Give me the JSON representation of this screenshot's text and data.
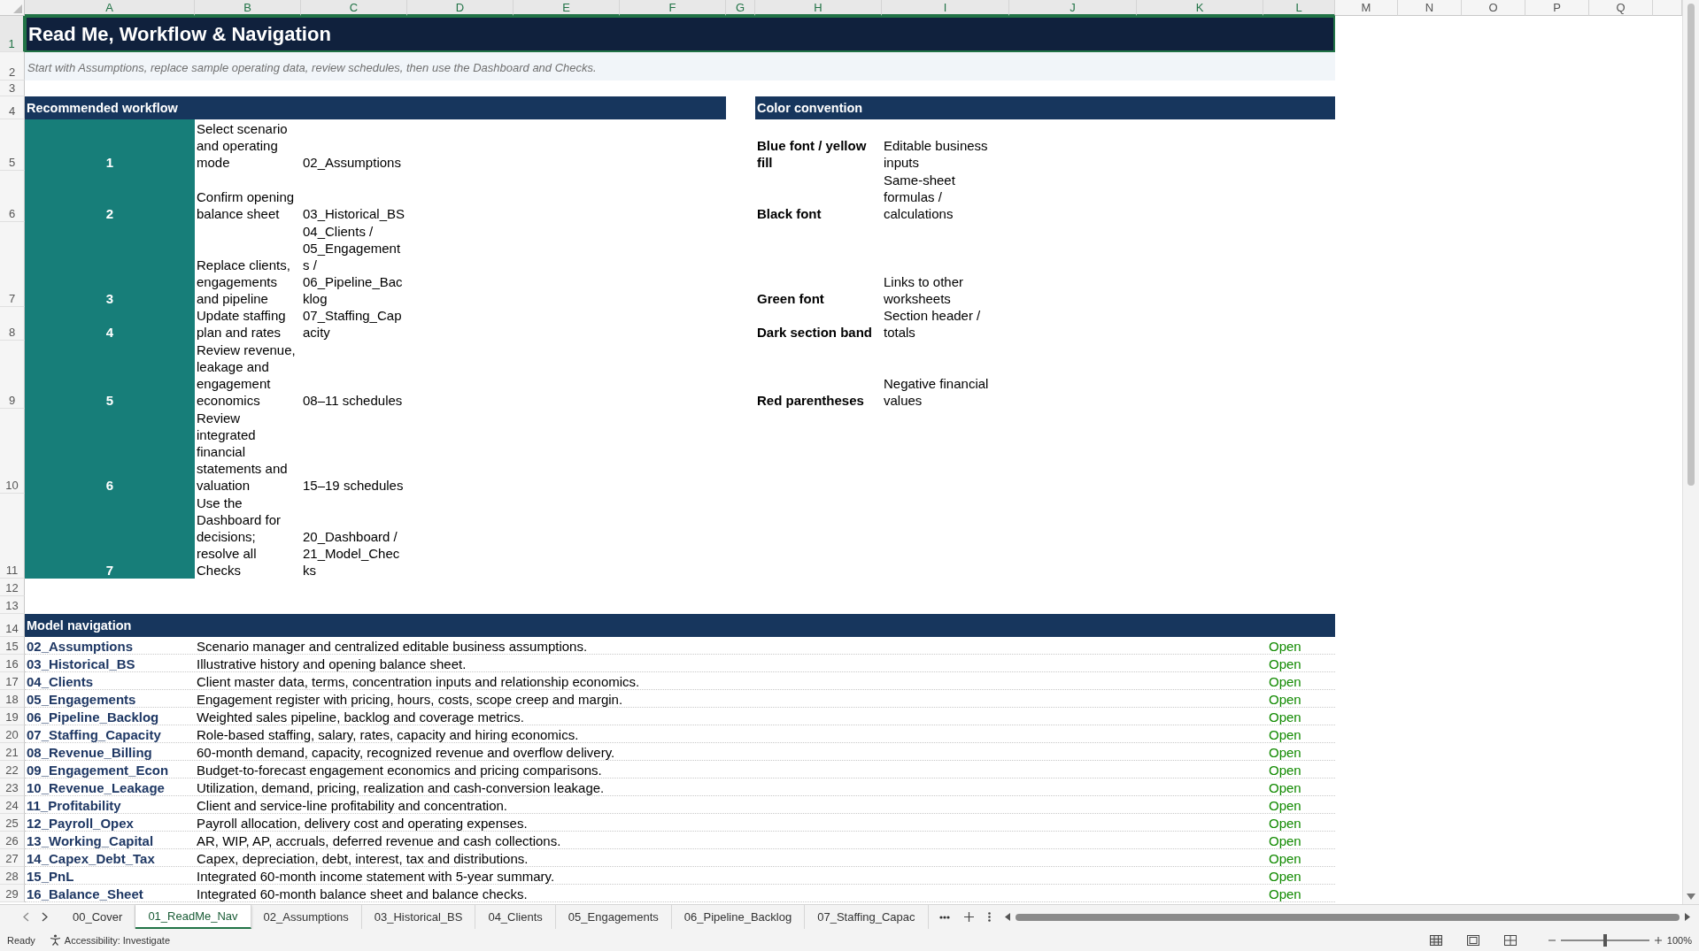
{
  "columns": [
    {
      "label": "A",
      "selected": true
    },
    {
      "label": "B",
      "selected": true
    },
    {
      "label": "C",
      "selected": true
    },
    {
      "label": "D",
      "selected": true
    },
    {
      "label": "E",
      "selected": true
    },
    {
      "label": "F",
      "selected": true
    },
    {
      "label": "G",
      "selected": true
    },
    {
      "label": "H",
      "selected": true
    },
    {
      "label": "I",
      "selected": true
    },
    {
      "label": "J",
      "selected": true
    },
    {
      "label": "K",
      "selected": true
    },
    {
      "label": "L",
      "selected": true
    },
    {
      "label": "M",
      "selected": false
    },
    {
      "label": "N",
      "selected": false
    },
    {
      "label": "O",
      "selected": false
    },
    {
      "label": "P",
      "selected": false
    },
    {
      "label": "Q",
      "selected": false
    }
  ],
  "rows": [
    {
      "label": "1",
      "selected": true
    },
    {
      "label": "2",
      "selected": false
    },
    {
      "label": "3",
      "selected": false
    },
    {
      "label": "4",
      "selected": false
    },
    {
      "label": "5",
      "selected": false
    },
    {
      "label": "6",
      "selected": false
    },
    {
      "label": "7",
      "selected": false
    },
    {
      "label": "8",
      "selected": false
    },
    {
      "label": "9",
      "selected": false
    },
    {
      "label": "10",
      "selected": false
    },
    {
      "label": "11",
      "selected": false
    },
    {
      "label": "12",
      "selected": false
    },
    {
      "label": "13",
      "selected": false
    },
    {
      "label": "14",
      "selected": false
    },
    {
      "label": "15",
      "selected": false
    },
    {
      "label": "16",
      "selected": false
    },
    {
      "label": "17",
      "selected": false
    },
    {
      "label": "18",
      "selected": false
    },
    {
      "label": "19",
      "selected": false
    },
    {
      "label": "20",
      "selected": false
    },
    {
      "label": "21",
      "selected": false
    },
    {
      "label": "22",
      "selected": false
    },
    {
      "label": "23",
      "selected": false
    },
    {
      "label": "24",
      "selected": false
    },
    {
      "label": "25",
      "selected": false
    },
    {
      "label": "26",
      "selected": false
    },
    {
      "label": "27",
      "selected": false
    },
    {
      "label": "28",
      "selected": false
    },
    {
      "label": "29",
      "selected": false
    }
  ],
  "title": "Read Me, Workflow & Navigation",
  "subtitle": "Start with Assumptions, replace sample operating data, review schedules, then use the Dashboard and Checks.",
  "workflow": {
    "heading": "Recommended workflow",
    "steps": [
      {
        "number": "1",
        "task": "Select scenario and operating mode",
        "sheets": "02_Assumptions"
      },
      {
        "number": "2",
        "task": "Confirm opening balance sheet",
        "sheets": "03_Historical_BS"
      },
      {
        "number": "3",
        "task": "Replace clients, engagements and pipeline",
        "sheets": "04_Clients / 05_Engagements / 06_Pipeline_Backlog"
      },
      {
        "number": "4",
        "task": "Update staffing plan and rates",
        "sheets": "07_Staffing_Capacity"
      },
      {
        "number": "5",
        "task": "Review revenue, leakage and engagement economics",
        "sheets": "08–11 schedules"
      },
      {
        "number": "6",
        "task": "Review integrated financial statements and valuation",
        "sheets": "15–19 schedules"
      },
      {
        "number": "7",
        "task": "Use the Dashboard for decisions; resolve all Checks",
        "sheets": "20_Dashboard / 21_Model_Checks"
      }
    ]
  },
  "color_convention": {
    "heading": "Color convention",
    "items": [
      {
        "label": "Blue font / yellow fill",
        "meaning": "Editable business inputs"
      },
      {
        "label": "Black font",
        "meaning": "Same-sheet formulas / calculations"
      },
      {
        "label": "Green font",
        "meaning": "Links to other worksheets"
      },
      {
        "label": "Dark section band",
        "meaning": "Section header / totals"
      },
      {
        "label": "Red parentheses",
        "meaning": "Negative financial values"
      }
    ]
  },
  "navigation": {
    "heading": "Model navigation",
    "links": [
      {
        "sheet": "02_Assumptions",
        "description": "Scenario manager and centralized editable business assumptions.",
        "action": "Open"
      },
      {
        "sheet": "03_Historical_BS",
        "description": "Illustrative history and opening balance sheet.",
        "action": "Open"
      },
      {
        "sheet": "04_Clients",
        "description": "Client master data, terms, concentration inputs and relationship economics.",
        "action": "Open"
      },
      {
        "sheet": "05_Engagements",
        "description": "Engagement register with pricing, hours, costs, scope creep and margin.",
        "action": "Open"
      },
      {
        "sheet": "06_Pipeline_Backlog",
        "description": "Weighted sales pipeline, backlog and coverage metrics.",
        "action": "Open"
      },
      {
        "sheet": "07_Staffing_Capacity",
        "description": "Role-based staffing, salary, rates, capacity and hiring economics.",
        "action": "Open"
      },
      {
        "sheet": "08_Revenue_Billing",
        "description": "60-month demand, capacity, recognized revenue and overflow delivery.",
        "action": "Open"
      },
      {
        "sheet": "09_Engagement_Econ",
        "description": "Budget-to-forecast engagement economics and pricing comparisons.",
        "action": "Open"
      },
      {
        "sheet": "10_Revenue_Leakage",
        "description": "Utilization, demand, pricing, realization and cash-conversion leakage.",
        "action": "Open"
      },
      {
        "sheet": "11_Profitability",
        "description": "Client and service-line profitability and concentration.",
        "action": "Open"
      },
      {
        "sheet": "12_Payroll_Opex",
        "description": "Payroll allocation, delivery cost and operating expenses.",
        "action": "Open"
      },
      {
        "sheet": "13_Working_Capital",
        "description": "AR, WIP, AP, accruals, deferred revenue and cash collections.",
        "action": "Open"
      },
      {
        "sheet": "14_Capex_Debt_Tax",
        "description": "Capex, depreciation, debt, interest, tax and distributions.",
        "action": "Open"
      },
      {
        "sheet": "15_PnL",
        "description": "Integrated 60-month income statement with 5-year summary.",
        "action": "Open"
      },
      {
        "sheet": "16_Balance_Sheet",
        "description": "Integrated 60-month balance sheet and balance checks.",
        "action": "Open"
      }
    ]
  },
  "sheet_tabs": [
    {
      "label": "00_Cover",
      "selected": false
    },
    {
      "label": "01_ReadMe_Nav",
      "selected": true
    },
    {
      "label": "02_Assumptions",
      "selected": false
    },
    {
      "label": "03_Historical_BS",
      "selected": false
    },
    {
      "label": "04_Clients",
      "selected": false
    },
    {
      "label": "05_Engagements",
      "selected": false
    },
    {
      "label": "06_Pipeline_Backlog",
      "selected": false
    },
    {
      "label": "07_Staffing_Capac",
      "selected": false
    }
  ],
  "status_bar": {
    "mode": "Ready",
    "accessibility": "Accessibility: Investigate",
    "zoom_slider": {
      "level": 0.5
    },
    "zoom": "100%"
  }
}
